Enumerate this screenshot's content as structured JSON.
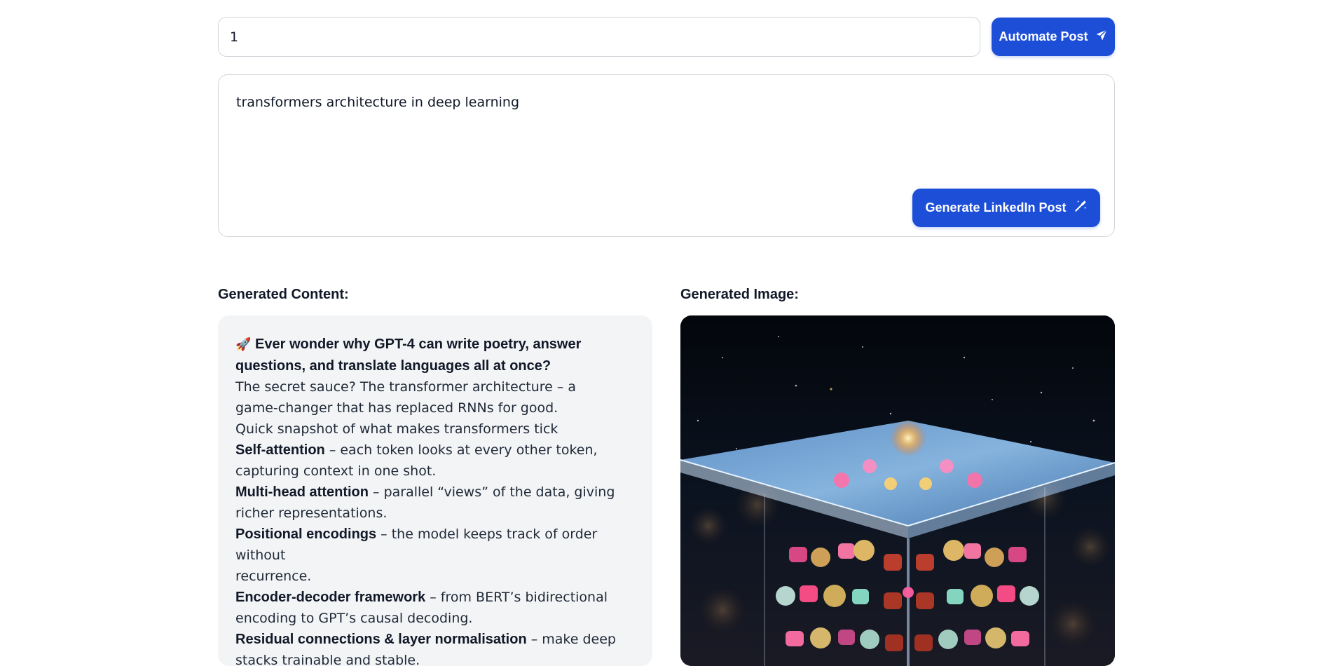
{
  "automate": {
    "input_value": "1",
    "button_label": "Automate Post",
    "button_icon": "send-icon"
  },
  "prompt": {
    "text": "transformers architecture in deep learning",
    "button_label": "Generate LinkedIn Post",
    "button_icon": "magic-wand-icon"
  },
  "content": {
    "section_label": "Generated Content:",
    "headline_icon": "rocket-icon",
    "headline_emoji": "🚀",
    "headline_line1": "Ever wonder why GPT-4 can write poetry, answer",
    "headline_line2": "questions, and translate languages all at once?",
    "intro_line1": "The secret sauce? The transformer architecture – a",
    "intro_line2": "game-changer that has replaced RNNs for good.",
    "snapshot": "Quick snapshot of what makes transformers tick",
    "points": [
      {
        "term": "Self-attention",
        "line1": " – each token looks at every other token,",
        "line2": "capturing context in one shot."
      },
      {
        "term": "Multi-head attention",
        "line1": " – parallel “views” of the data, giving",
        "line2": "richer representations."
      },
      {
        "term": "Positional encodings",
        "line1": " – the model keeps track of order without",
        "line2": "recurrence."
      },
      {
        "term": "Encoder-decoder framework",
        "line1": " – from BERT’s bidirectional",
        "line2": "encoding to GPT’s causal decoding."
      },
      {
        "term": "Residual connections & layer normalisation",
        "line1": " – make deep",
        "line2": "stacks trainable and stable."
      }
    ]
  },
  "image": {
    "section_label": "Generated Image:",
    "alt": "glowing transformer cube artwork"
  },
  "colors": {
    "primary": "#1d4ed8",
    "card_bg": "#f3f4f6",
    "border": "#d1d5db"
  }
}
